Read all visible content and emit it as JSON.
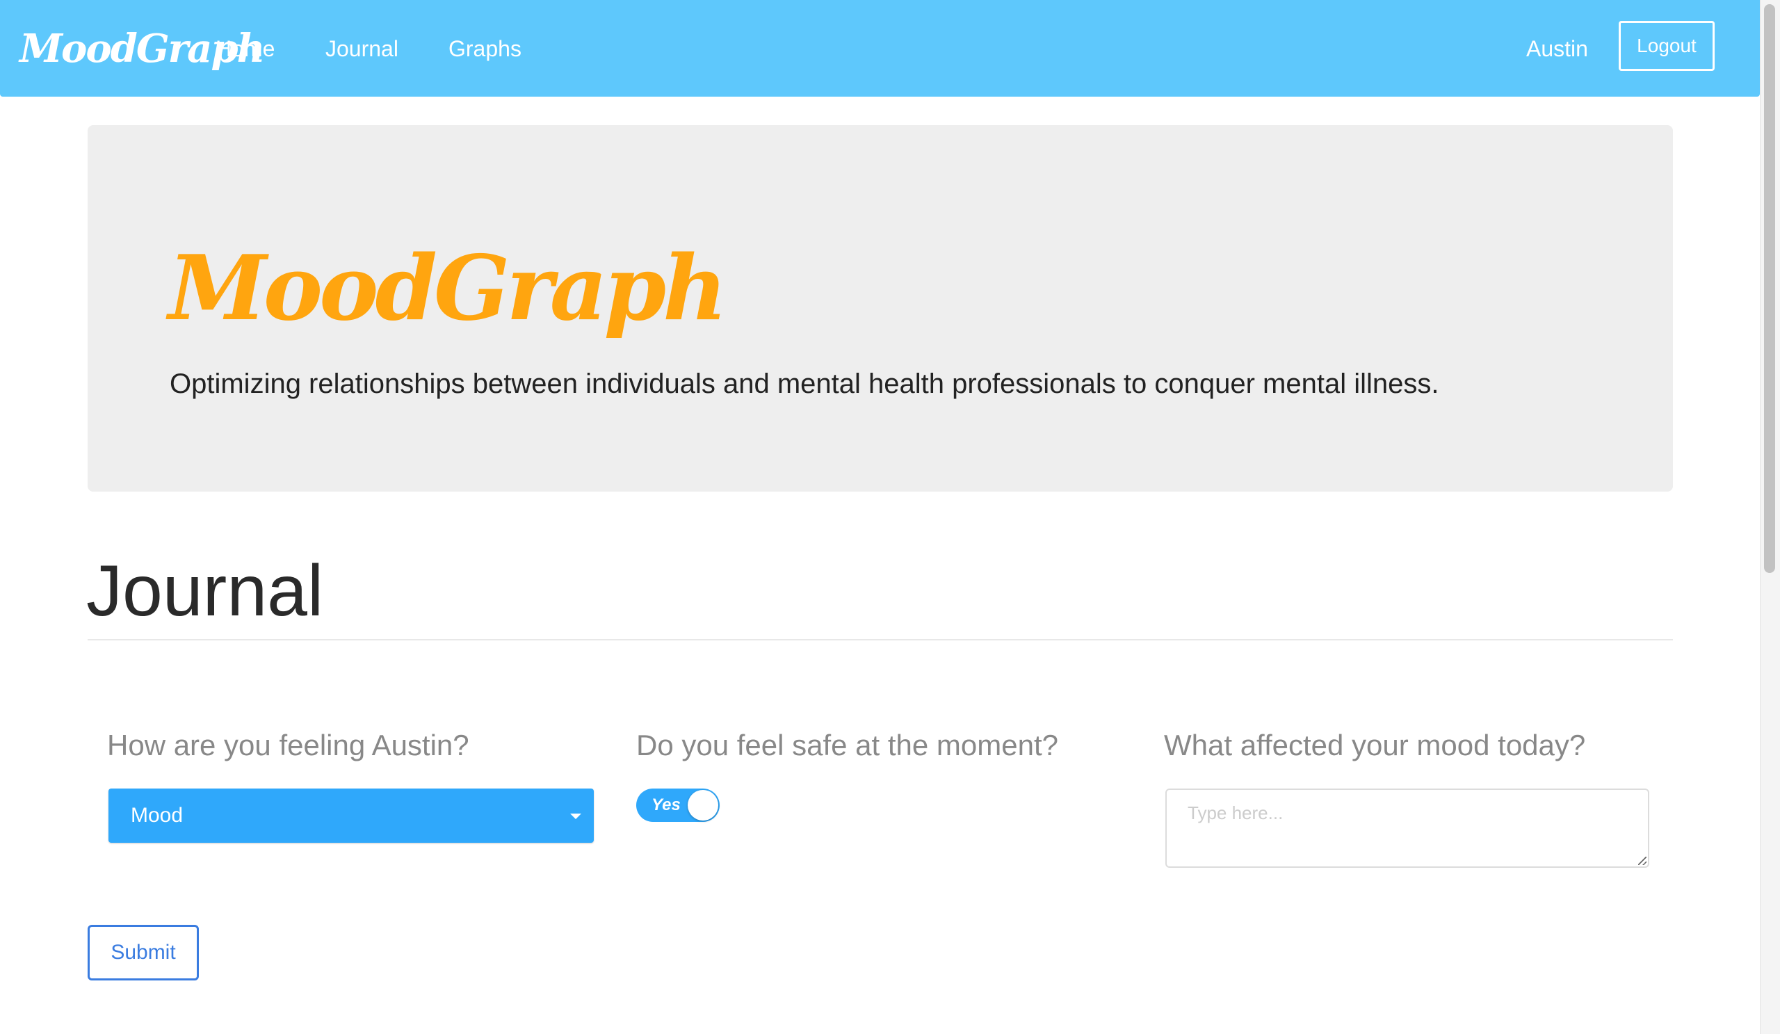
{
  "navbar": {
    "brand": "MoodGraph",
    "links": [
      "Home",
      "Journal",
      "Graphs"
    ],
    "user_name": "Austin",
    "logout_label": "Logout"
  },
  "hero": {
    "title": "MoodGraph",
    "subtitle": "Optimizing relationships between individuals and mental health professionals to conquer mental illness."
  },
  "journal": {
    "heading": "Journal",
    "questions": {
      "feeling": "How are you feeling Austin?",
      "safe": "Do you feel safe at the moment?",
      "affected": "What affected your mood today?"
    },
    "mood_select": {
      "selected": "Mood"
    },
    "safe_toggle": {
      "label": "Yes",
      "state": "on"
    },
    "mood_textarea": {
      "value": "",
      "placeholder": "Type here..."
    },
    "submit_label": "Submit"
  },
  "colors": {
    "navbar_bg": "#5ec8fc",
    "brand_orange": "#ffa50f",
    "select_blue": "#2fa8fb",
    "submit_blue": "#3a7ce0",
    "hero_bg": "#eeeeee"
  }
}
